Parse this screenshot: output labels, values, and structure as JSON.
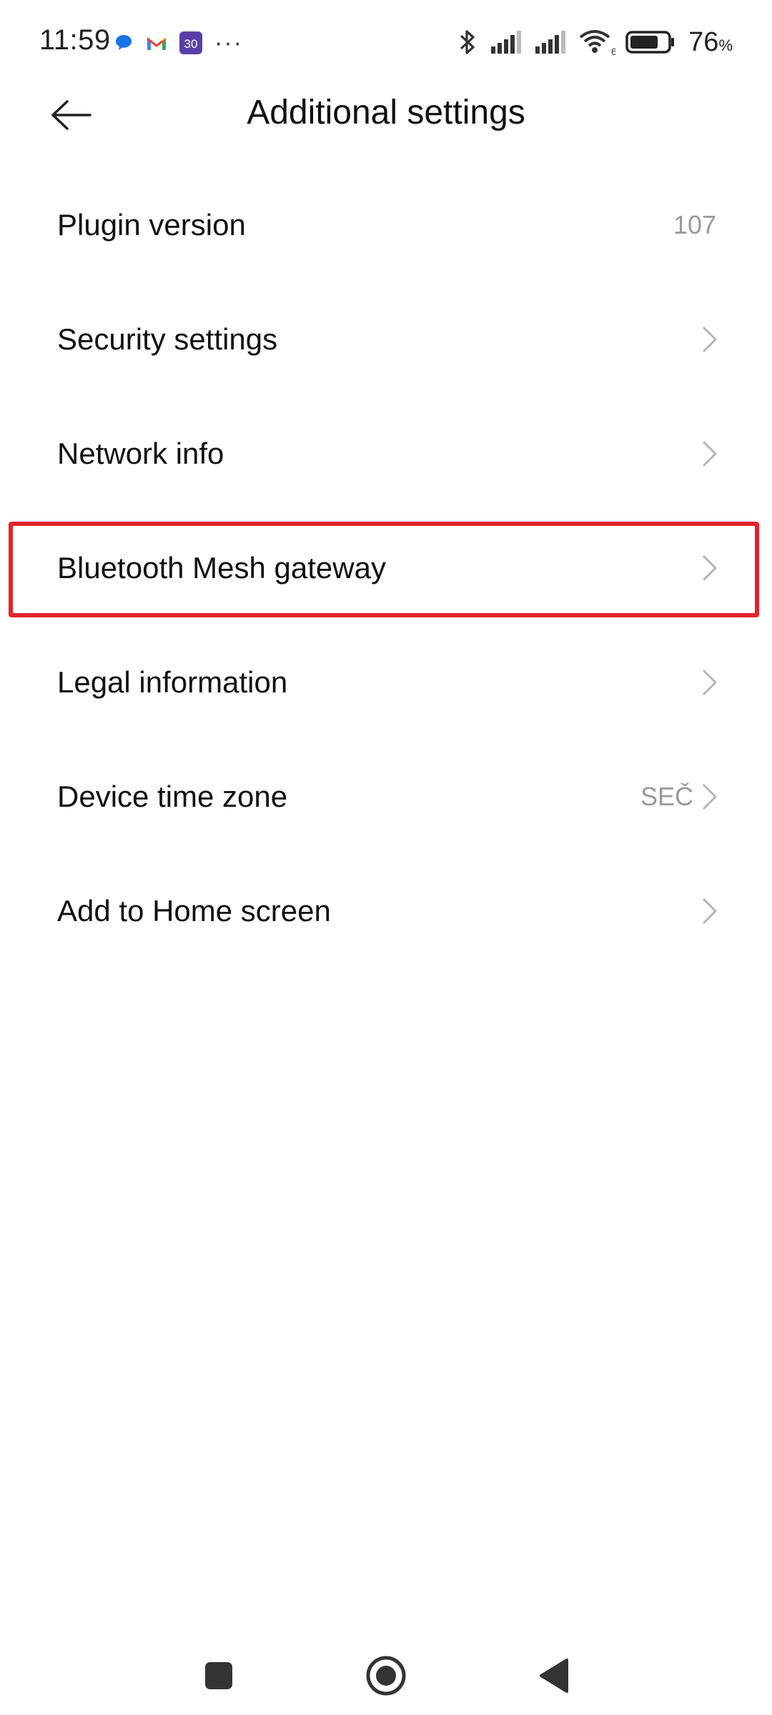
{
  "status_bar": {
    "time": "11:59",
    "more_notifications": "···",
    "calendar_badge": "30",
    "battery_percent": "76",
    "battery_percent_sign": "%",
    "wifi_badge": "6",
    "battery_level": 0.76
  },
  "header": {
    "title": "Additional settings",
    "back_icon": "arrow-left-icon"
  },
  "settings": {
    "items": [
      {
        "label": "Plugin version",
        "value": "107",
        "chevron": false
      },
      {
        "label": "Security settings",
        "value": "",
        "chevron": true
      },
      {
        "label": "Network info",
        "value": "",
        "chevron": true
      },
      {
        "label": "Bluetooth Mesh gateway",
        "value": "",
        "chevron": true,
        "highlighted": true
      },
      {
        "label": "Legal information",
        "value": "",
        "chevron": true
      },
      {
        "label": "Device time zone",
        "value": "SEČ",
        "chevron": true
      },
      {
        "label": "Add to Home screen",
        "value": "",
        "chevron": true
      }
    ]
  },
  "colors": {
    "highlight": "#e3242b",
    "secondary_text": "#9a9a9a",
    "chevron": "#b5b5b5"
  },
  "nav_bar": {
    "recents_icon": "square-icon",
    "home_icon": "circle-home-icon",
    "back_icon": "triangle-back-icon"
  }
}
